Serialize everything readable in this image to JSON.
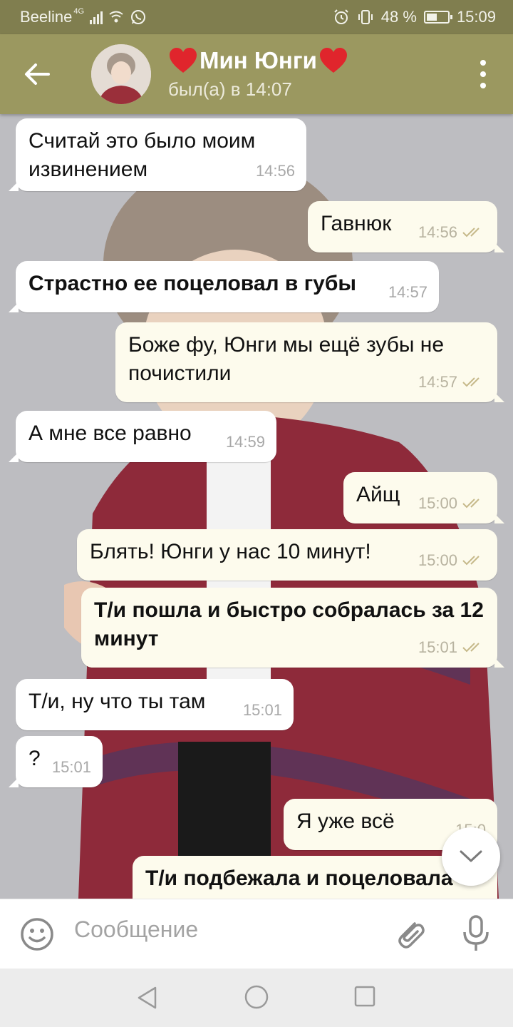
{
  "status_bar": {
    "carrier": "Beeline",
    "network": "4G",
    "battery": "48 %",
    "time": "15:09"
  },
  "header": {
    "contact_name": "Мин Юнги",
    "status": "был(а) в 14:07",
    "heart_icon": "red-heart-emoji",
    "accent": "#9b9860"
  },
  "messages": [
    {
      "direction": "in",
      "bold": false,
      "text": "Считай это было моим извинением",
      "time": "14:56"
    },
    {
      "direction": "out",
      "bold": false,
      "text": "Гавнюк",
      "time": "14:56",
      "read": true
    },
    {
      "direction": "in",
      "bold": true,
      "text": "Страстно ее поцеловал в губы",
      "time": "14:57"
    },
    {
      "direction": "out",
      "bold": false,
      "text": "Боже фу, Юнги мы ещё зубы не почистили",
      "time": "14:57",
      "read": true
    },
    {
      "direction": "in",
      "bold": false,
      "text": "А мне все равно",
      "time": "14:59"
    },
    {
      "direction": "out",
      "bold": false,
      "text": "Айщ",
      "time": "15:00",
      "read": true
    },
    {
      "direction": "out",
      "bold": false,
      "text": "Блять! Юнги у нас 10 минут!",
      "time": "15:00",
      "read": true
    },
    {
      "direction": "out",
      "bold": true,
      "text": "Т/и пошла и быстро собралась за 12 минут",
      "time": "15:01",
      "read": true
    },
    {
      "direction": "in",
      "bold": false,
      "text": "Т/и, ну что ты там",
      "time": "15:01"
    },
    {
      "direction": "in",
      "bold": false,
      "text": "?",
      "time": "15:01"
    },
    {
      "direction": "out",
      "bold": false,
      "text": "Я уже всё",
      "time": "15:0",
      "read": true
    },
    {
      "direction": "out",
      "bold": true,
      "text": "Т/и подбежала и поцеловала",
      "time": ""
    }
  ],
  "input": {
    "placeholder": "Сообщение"
  },
  "icons": {
    "back": "arrow-left-icon",
    "menu": "more-vertical-icon",
    "emoji": "smiley-icon",
    "attach": "paperclip-icon",
    "mic": "microphone-icon",
    "scroll": "chevron-down-icon",
    "read": "double-check-icon"
  }
}
